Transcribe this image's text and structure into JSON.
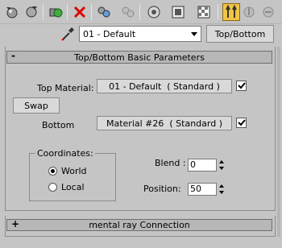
{
  "toolbar": {
    "icons": [
      "get-material-icon",
      "put-to-scene-icon",
      "assign-to-selection-icon",
      "reset-map-icon",
      "make-unique-icon",
      "put-to-library-icon",
      "material-id-channel-icon",
      "show-map-in-viewport-icon",
      "show-end-result-icon",
      "go-to-parent-icon",
      "go-forward-to-sibling-icon"
    ],
    "active": "go-to-parent-icon"
  },
  "material": {
    "name": "01 - Default",
    "type_button": "Top/Bottom"
  },
  "rollout": {
    "sign": "-",
    "title": "Top/Bottom Basic Parameters",
    "top_label": "Top Material:",
    "top_map": "01 - Default  ( Standard )",
    "top_enabled": true,
    "swap": "Swap",
    "bottom_label": "Bottom",
    "bottom_map": "Material #26  ( Standard )",
    "bottom_enabled": true,
    "coordinates": {
      "title": "Coordinates:",
      "options": [
        "World",
        "Local"
      ],
      "selected": "World"
    },
    "blend_label": "Blend :",
    "blend_value": "0",
    "position_label": "Position:",
    "position_value": "50"
  },
  "collapsed_rollout": {
    "sign": "+",
    "title": "mental ray Connection"
  },
  "colors": {
    "background": "#c5c5c5",
    "active_button": "#f2c442",
    "rollout_header": "#b7b7b7"
  }
}
